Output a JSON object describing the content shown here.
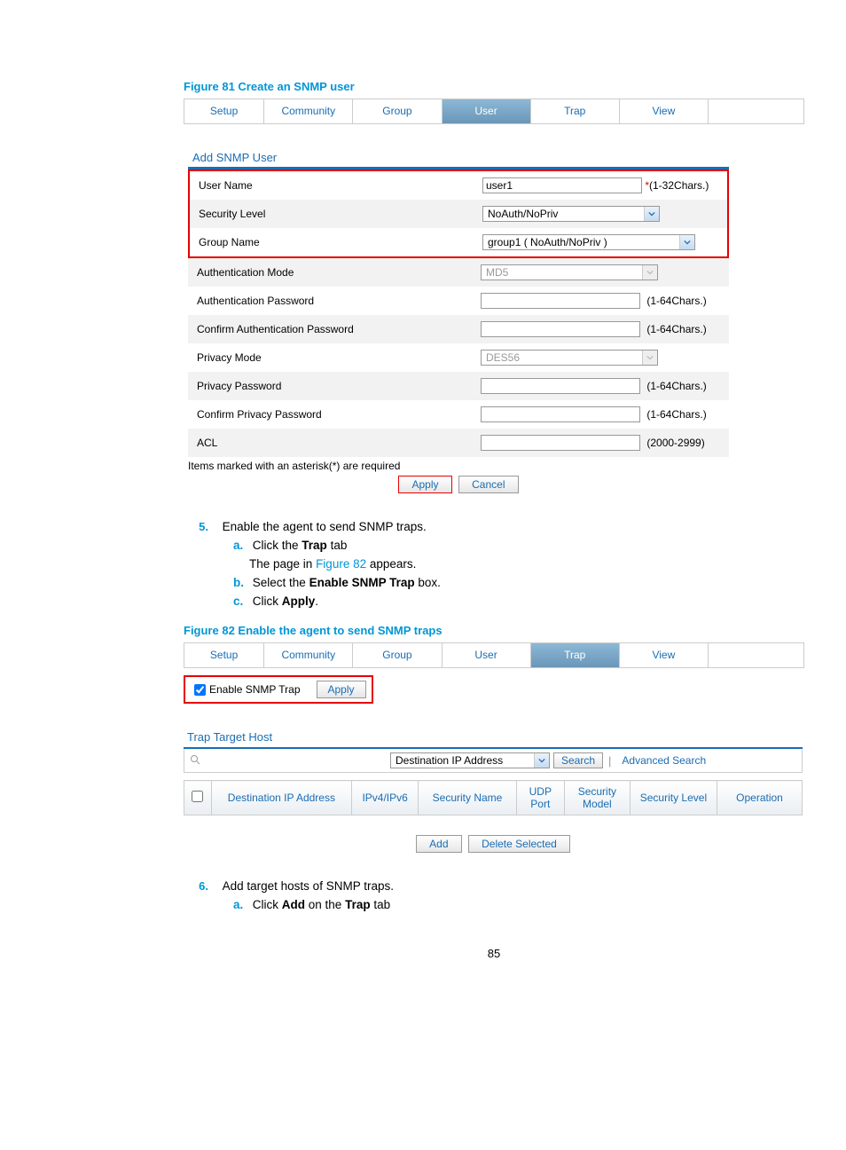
{
  "figure81_caption": "Figure 81 Create an SNMP user",
  "tabs1": [
    "Setup",
    "Community",
    "Group",
    "User",
    "Trap",
    "View",
    ""
  ],
  "tabs1_active_index": 3,
  "tabs1_widths": [
    90,
    100,
    100,
    100,
    100,
    100,
    108
  ],
  "panel1_title": "Add SNMP User",
  "form": {
    "user_name_label": "User Name",
    "user_name_value": "user1",
    "user_name_hint_prefix": "*",
    "user_name_hint": "(1-32Chars.)",
    "security_level_label": "Security Level",
    "security_level_value": "NoAuth/NoPriv",
    "group_name_label": "Group Name",
    "group_name_value": "group1 ( NoAuth/NoPriv )",
    "auth_mode_label": "Authentication Mode",
    "auth_mode_value": "MD5",
    "auth_pw_label": "Authentication Password",
    "auth_pw_hint": "(1-64Chars.)",
    "conf_auth_pw_label": "Confirm Authentication Password",
    "conf_auth_pw_hint": "(1-64Chars.)",
    "priv_mode_label": "Privacy Mode",
    "priv_mode_value": "DES56",
    "priv_pw_label": "Privacy Password",
    "priv_pw_hint": "(1-64Chars.)",
    "conf_priv_pw_label": "Confirm Privacy Password",
    "conf_priv_pw_hint": "(1-64Chars.)",
    "acl_label": "ACL",
    "acl_hint": "(2000-2999)"
  },
  "required_note": "Items marked with an asterisk(*) are required",
  "apply_label": "Apply",
  "cancel_label": "Cancel",
  "step5_num": "5.",
  "step5_text": "Enable the agent to send SNMP traps.",
  "step5a_letter": "a.",
  "step5a_pre": "Click the ",
  "step5a_bold": "Trap",
  "step5a_post": " tab",
  "step5a_line2_pre": "The page in ",
  "step5a_line2_link": "Figure 82",
  "step5a_line2_post": " appears.",
  "step5b_letter": "b.",
  "step5b_pre": "Select the ",
  "step5b_bold": "Enable SNMP Trap",
  "step5b_post": " box.",
  "step5c_letter": "c.",
  "step5c_pre": "Click ",
  "step5c_bold": "Apply",
  "step5c_post": ".",
  "figure82_caption": "Figure 82 Enable the agent to send SNMP traps",
  "tabs2": [
    "Setup",
    "Community",
    "Group",
    "User",
    "Trap",
    "View",
    ""
  ],
  "tabs2_active_index": 4,
  "tabs2_widths": [
    90,
    100,
    100,
    100,
    100,
    100,
    108
  ],
  "enable_trap_label": "Enable SNMP Trap",
  "enable_trap_checked": true,
  "tth_title": "Trap Target Host",
  "search_field_select": "Destination IP Address",
  "search_button": "Search",
  "advanced_search": "Advanced Search",
  "tth_headers": [
    "",
    "Destination IP Address",
    "IPv4/IPv6",
    "Security Name",
    "UDP Port",
    "Security Model",
    "Security Level",
    "Operation"
  ],
  "add_label": "Add",
  "delete_selected_label": "Delete Selected",
  "step6_num": "6.",
  "step6_text": "Add target hosts of SNMP traps.",
  "step6a_letter": "a.",
  "step6a_pre": "Click ",
  "step6a_bold": "Add",
  "step6a_mid": " on the ",
  "step6a_bold2": "Trap",
  "step6a_post": " tab",
  "page_number": "85"
}
